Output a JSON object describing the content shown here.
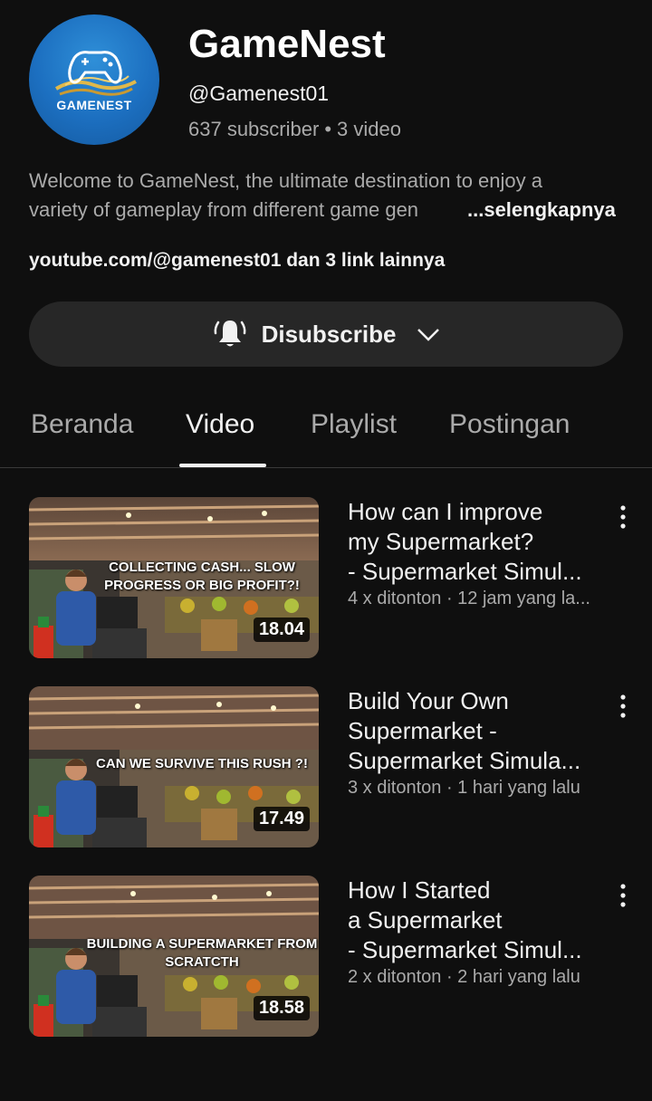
{
  "channel": {
    "avatar_text": "GAMENEST",
    "name": "GameNest",
    "handle": "@Gamenest01",
    "subscribers": "637 subscriber",
    "separator": "•",
    "videos": "3 video",
    "description_line1": "Welcome to GameNest, the ultimate destination to enjoy a",
    "description_line2": "variety of gameplay from different game gen",
    "more_label": "...selengkapnya",
    "links": "youtube.com/@gamenest01 dan 3 link lainnya"
  },
  "subscribe_button": {
    "label": "Disubscribe",
    "icon": "bell-ringing-icon"
  },
  "tabs": [
    {
      "label": "Beranda",
      "active": false
    },
    {
      "label": "Video",
      "active": true
    },
    {
      "label": "Playlist",
      "active": false
    },
    {
      "label": "Postingan",
      "active": false
    }
  ],
  "videos": [
    {
      "thumb_text": "COLLECTING CASH... SLOW PROGRESS OR BIG PROFIT?!",
      "duration": "18.04",
      "title": "How can I improve\nmy Supermarket?\n- Supermarket Simul...",
      "meta": "4 x ditonton · 12 jam yang la..."
    },
    {
      "thumb_text": "CAN WE SURVIVE THIS RUSH ?!",
      "duration": "17.49",
      "title": "Build Your Own\nSupermarket -\nSupermarket Simula...",
      "meta": "3 x ditonton · 1 hari yang lalu"
    },
    {
      "thumb_text": "BUILDING A SUPERMARKET FROM SCRATCTH",
      "duration": "18.58",
      "title": "How I Started\na Supermarket\n- Supermarket Simul...",
      "meta": "2 x ditonton · 2 hari yang lalu"
    }
  ],
  "colors": {
    "background": "#0f0f0f",
    "button_bg": "#272727",
    "secondary_text": "#aaaaaa",
    "avatar_blue": "#1c6fc0"
  }
}
